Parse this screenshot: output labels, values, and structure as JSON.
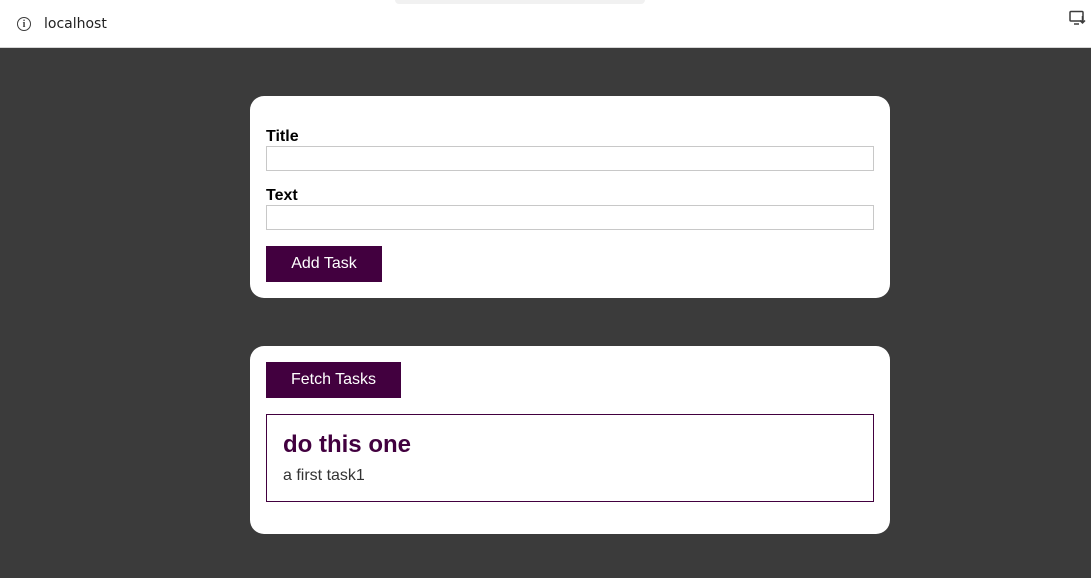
{
  "browser": {
    "url": "localhost",
    "info_icon": "info-icon",
    "install_icon": "install-app-icon"
  },
  "form": {
    "title_label": "Title",
    "title_value": "",
    "text_label": "Text",
    "text_value": "",
    "add_button_label": "Add Task"
  },
  "tasks_panel": {
    "fetch_button_label": "Fetch Tasks",
    "items": [
      {
        "title": "do this one",
        "text": "a first task1"
      }
    ]
  },
  "colors": {
    "page_background": "#3b3b3b",
    "accent": "#42003f",
    "card_background": "#ffffff"
  }
}
